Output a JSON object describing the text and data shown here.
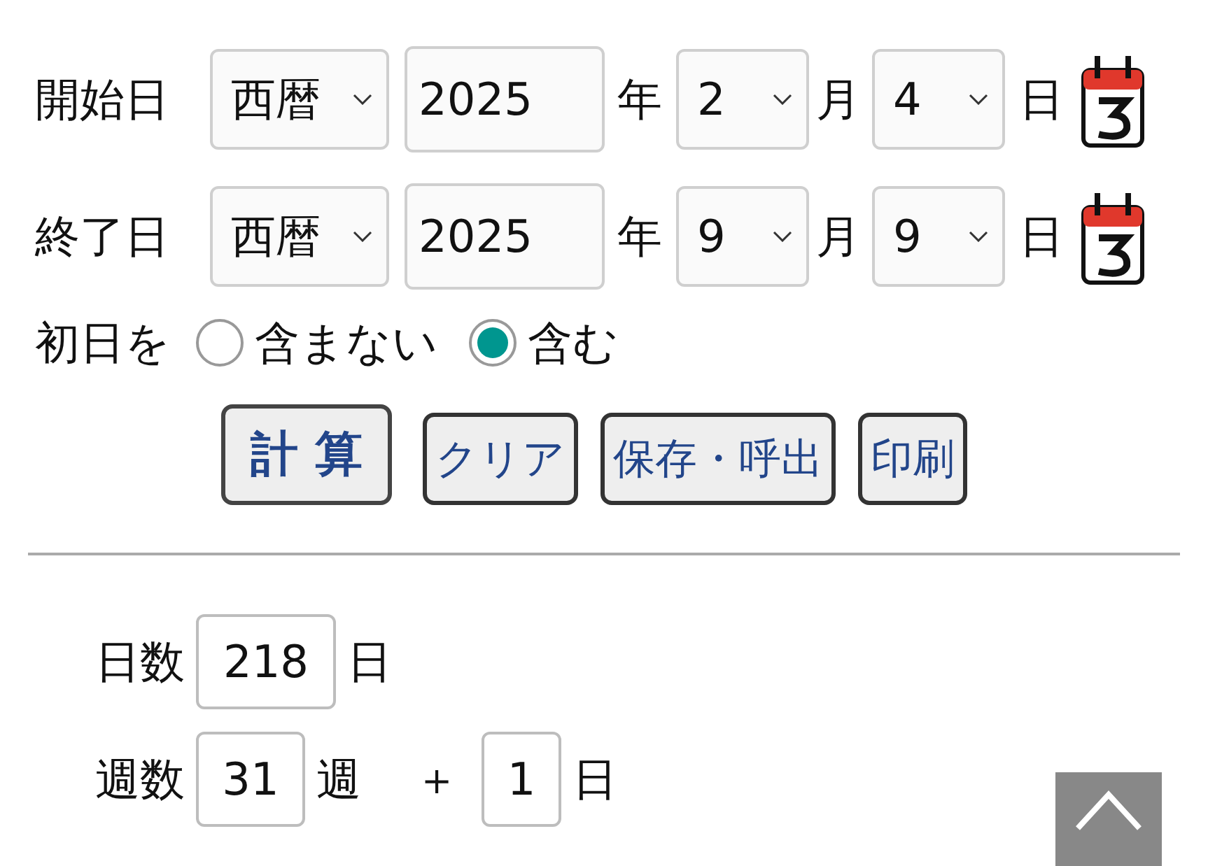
{
  "date_rows": [
    {
      "label": "開始日",
      "era": "西暦",
      "year": "2025",
      "year_unit": "年",
      "month": "2",
      "month_unit": "月",
      "day": "4",
      "day_unit": "日"
    },
    {
      "label": "終了日",
      "era": "西暦",
      "year": "2025",
      "year_unit": "年",
      "month": "9",
      "month_unit": "月",
      "day": "9",
      "day_unit": "日"
    }
  ],
  "first_day": {
    "label": "初日を",
    "options": [
      {
        "label": "含まない",
        "selected": false
      },
      {
        "label": "含む",
        "selected": true
      }
    ]
  },
  "buttons": [
    {
      "label": "計 算",
      "kind": "primary"
    },
    {
      "label": "クリア",
      "kind": "normal"
    },
    {
      "label": "保存・呼出",
      "kind": "normal"
    },
    {
      "label": "印刷",
      "kind": "normal"
    }
  ],
  "days": {
    "label": "日数",
    "value": "218",
    "unit": "日"
  },
  "weeks": {
    "label": "週数",
    "value": "31",
    "unit": "週",
    "plus": "＋",
    "extra_days": "1",
    "extra_unit": "日"
  }
}
